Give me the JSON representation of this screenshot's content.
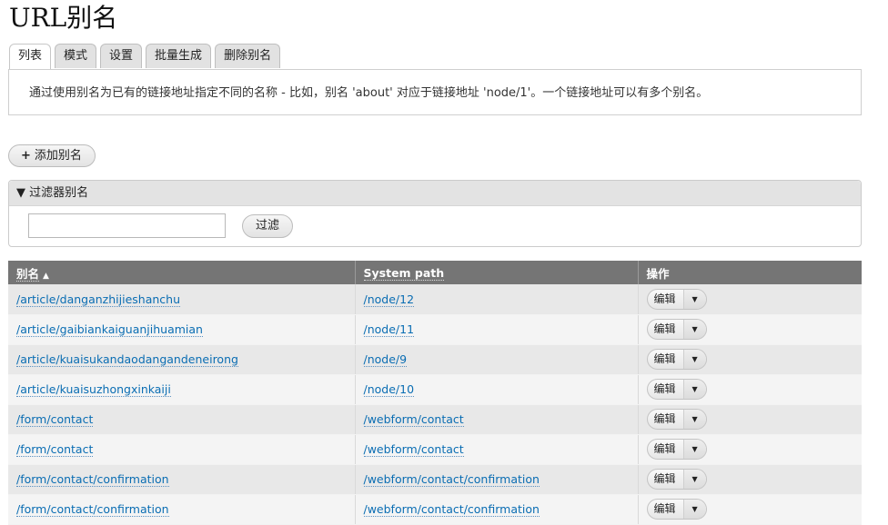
{
  "page": {
    "title": "URL别名"
  },
  "tabs": [
    {
      "label": "列表",
      "active": true
    },
    {
      "label": "模式",
      "active": false
    },
    {
      "label": "设置",
      "active": false
    },
    {
      "label": "批量生成",
      "active": false
    },
    {
      "label": "删除别名",
      "active": false
    }
  ],
  "help": {
    "text": "通过使用别名为已有的链接地址指定不同的名称 - 比如，别名 'about' 对应于链接地址 'node/1'。一个链接地址可以有多个别名。"
  },
  "actions": {
    "add_label": "添加别名",
    "add_icon": "+"
  },
  "filter": {
    "header_label": "过滤器别名",
    "toggle_icon": "▼",
    "input_value": "",
    "input_placeholder": "",
    "submit_label": "过滤"
  },
  "table": {
    "headers": {
      "alias": "别名",
      "system_path": "System path",
      "operations": "操作"
    },
    "sort_icon": "▲",
    "rows": [
      {
        "alias": "/article/danganzhijieshanchu",
        "path": "/node/12",
        "op": "编辑"
      },
      {
        "alias": "/article/gaibiankaiguanjihuamian",
        "path": "/node/11",
        "op": "编辑"
      },
      {
        "alias": "/article/kuaisukandaodangandeneirong",
        "path": "/node/9",
        "op": "编辑"
      },
      {
        "alias": "/article/kuaisuzhongxinkaiji",
        "path": "/node/10",
        "op": "编辑"
      },
      {
        "alias": "/form/contact",
        "path": "/webform/contact",
        "op": "编辑"
      },
      {
        "alias": "/form/contact",
        "path": "/webform/contact",
        "op": "编辑"
      },
      {
        "alias": "/form/contact/confirmation",
        "path": "/webform/contact/confirmation",
        "op": "编辑"
      },
      {
        "alias": "/form/contact/confirmation",
        "path": "/webform/contact/confirmation",
        "op": "编辑"
      }
    ]
  },
  "colors": {
    "link": "#0a6db3",
    "header_bg": "#757575",
    "row_odd": "#e8e8e8",
    "row_even": "#f4f4f4"
  }
}
